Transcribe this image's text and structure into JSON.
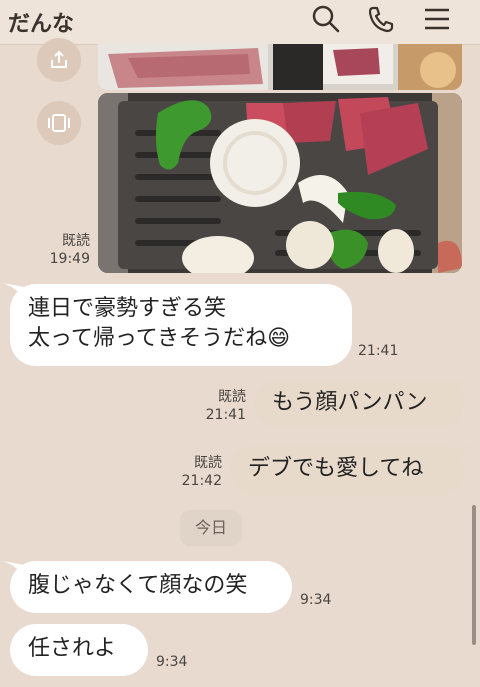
{
  "header": {
    "title": "だんな"
  },
  "messages": {
    "photo": {
      "read": "既読",
      "time": "19:49"
    },
    "m1": {
      "line1": "連日で豪勢すぎる笑",
      "line2": "太って帰ってきそうだね",
      "emoji": "😄",
      "time": "21:41"
    },
    "m2": {
      "text": "もう顔パンパン",
      "read": "既読",
      "time": "21:41"
    },
    "m3": {
      "text": "デブでも愛してね",
      "read": "既読",
      "time": "21:42"
    },
    "date_divider": "今日",
    "m4": {
      "text": "腹じゃなくて顔なの笑",
      "time": "9:34"
    },
    "m5": {
      "text": "任されよ",
      "time": "9:34"
    }
  },
  "colors": {
    "background": "#e8dacf",
    "incoming_bubble": "#ffffff",
    "outgoing_bubble": "#e7dacb"
  }
}
